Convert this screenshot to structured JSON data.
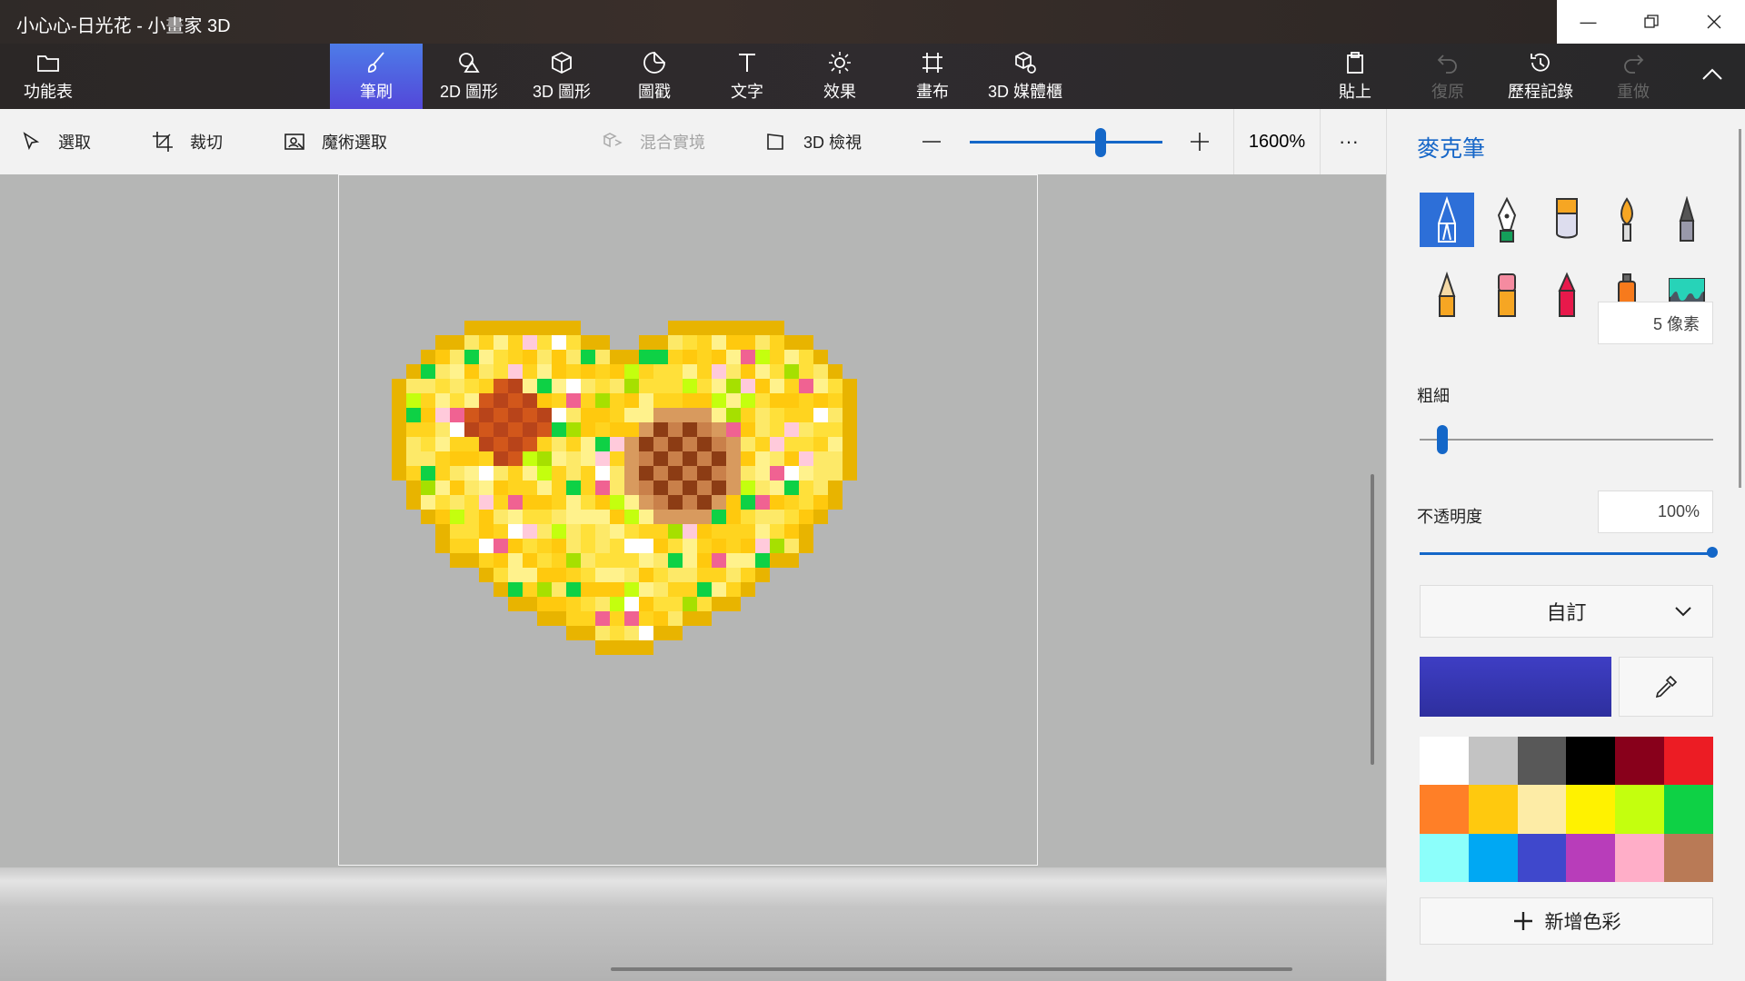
{
  "window": {
    "title": "小心心-日光花 - 小畫家 3D",
    "controls": [
      "minimize-icon",
      "restore-icon",
      "close-icon"
    ]
  },
  "ribbon": {
    "menu_label": "功能表",
    "tabs": [
      {
        "label": "筆刷",
        "icon": "brush-icon",
        "active": true
      },
      {
        "label": "2D 圖形",
        "icon": "2d-shapes-icon"
      },
      {
        "label": "3D 圖形",
        "icon": "3d-shapes-icon"
      },
      {
        "label": "圖戳",
        "icon": "stickers-icon"
      },
      {
        "label": "文字",
        "icon": "text-icon"
      },
      {
        "label": "效果",
        "icon": "effects-icon"
      },
      {
        "label": "畫布",
        "icon": "canvas-icon"
      },
      {
        "label": "3D 媒體櫃",
        "icon": "3d-library-icon"
      }
    ],
    "actions": [
      {
        "label": "貼上",
        "icon": "paste-icon",
        "enabled": true
      },
      {
        "label": "復原",
        "icon": "undo-icon",
        "enabled": false
      },
      {
        "label": "歷程記錄",
        "icon": "history-icon",
        "enabled": true
      },
      {
        "label": "重做",
        "icon": "redo-icon",
        "enabled": false
      }
    ]
  },
  "toolbar": {
    "select_label": "選取",
    "crop_label": "裁切",
    "magic_select_label": "魔術選取",
    "mixed_reality_label": "混合實境",
    "view3d_label": "3D 檢視",
    "zoom_value": "1600%",
    "zoom_level_fraction": 0.65,
    "more_label": "···"
  },
  "panel": {
    "title": "麥克筆",
    "brushes": [
      "marker-icon",
      "calligraphy-pen-icon",
      "oil-brush-icon",
      "watercolor-icon",
      "pixel-pen-icon",
      "pencil-icon",
      "eraser-icon",
      "crayon-icon",
      "spray-can-icon",
      "fill-bucket-icon"
    ],
    "thickness_label": "粗細",
    "thickness_value": "5 像素",
    "thickness_fraction": 0.06,
    "opacity_label": "不透明度",
    "opacity_value": "100%",
    "opacity_fraction": 1.0,
    "custom_label": "自訂",
    "current_color": "#3e3ec4",
    "palette": [
      "#ffffff",
      "#c3c3c3",
      "#585858",
      "#000000",
      "#88001b",
      "#ec1c24",
      "#ff7f27",
      "#ffc90e",
      "#fdeca6",
      "#fff200",
      "#c4ff0e",
      "#0ed145",
      "#8cfffb",
      "#00a8f3",
      "#3f48cc",
      "#b83dba",
      "#ffaec8",
      "#b97a56"
    ],
    "add_color_label": "新增色彩"
  },
  "canvas": {
    "content": "pixel-art-heart-with-sunflowers"
  }
}
